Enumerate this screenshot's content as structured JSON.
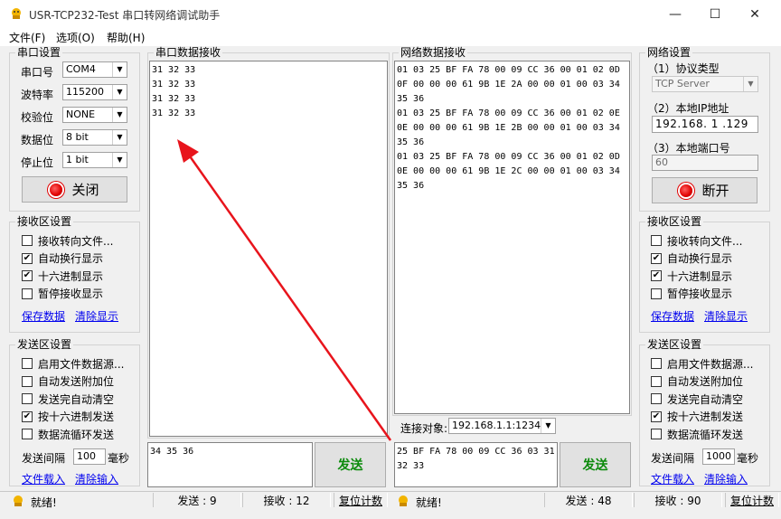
{
  "window": {
    "title": "USR-TCP232-Test 串口转网络调试助手",
    "minimize": "—",
    "maximize": "☐",
    "close": "✕"
  },
  "menu": [
    "文件(F)",
    "选项(O)",
    "帮助(H)"
  ],
  "serial_settings": {
    "title": "串口设置",
    "port_label": "串口号",
    "port_value": "COM4",
    "baud_label": "波特率",
    "baud_value": "115200",
    "parity_label": "校验位",
    "parity_value": "NONE",
    "databits_label": "数据位",
    "databits_value": "8 bit",
    "stopbits_label": "停止位",
    "stopbits_value": "1 bit",
    "close_button": "关闭"
  },
  "left_recv_settings": {
    "title": "接收区设置",
    "options": [
      {
        "label": "接收转向文件...",
        "checked": false
      },
      {
        "label": "自动换行显示",
        "checked": true
      },
      {
        "label": "十六进制显示",
        "checked": true
      },
      {
        "label": "暂停接收显示",
        "checked": false
      }
    ],
    "save_link": "保存数据",
    "clear_link": "清除显示"
  },
  "left_send_settings": {
    "title": "发送区设置",
    "options": [
      {
        "label": "启用文件数据源...",
        "checked": false
      },
      {
        "label": "自动发送附加位",
        "checked": false
      },
      {
        "label": "发送完自动清空",
        "checked": false
      },
      {
        "label": "按十六进制发送",
        "checked": true
      },
      {
        "label": "数据流循环发送",
        "checked": false
      }
    ],
    "interval_label": "发送间隔",
    "interval_value": "100",
    "interval_unit": "毫秒",
    "load_link": "文件载入",
    "clear_link": "清除输入"
  },
  "serial_recv": {
    "title": "串口数据接收",
    "content": "31 32 33\n31 32 33\n31 32 33\n31 32 33"
  },
  "serial_send": {
    "content": "34 35 36",
    "send_button": "发送"
  },
  "net_recv": {
    "title": "网络数据接收",
    "content": "01 03 25 BF FA 78 00 09 CC 36 00 01 02 0D 0F 00 00 00 61 9B 1E 2A 00 00 01 00 03 34 35 36\n01 03 25 BF FA 78 00 09 CC 36 00 01 02 0E 0E 00 00 00 61 9B 1E 2B 00 00 01 00 03 34 35 36\n01 03 25 BF FA 78 00 09 CC 36 00 01 02 0D 0E 00 00 00 61 9B 1E 2C 00 00 01 00 03 34 35 36"
  },
  "connect": {
    "label": "连接对象:",
    "value": "192.168.1.1:1234"
  },
  "net_send": {
    "content": "25 BF FA 78 00 09 CC 36 03 31 32 33",
    "send_button": "发送"
  },
  "net_settings": {
    "title": "网络设置",
    "protocol_label": "（1）协议类型",
    "protocol_value": "TCP Server",
    "ip_label": "（2）本地IP地址",
    "ip_value": "192.168. 1 .129",
    "port_label": "（3）本地端口号",
    "port_value": "60",
    "open_button": "断开"
  },
  "right_recv_settings": {
    "title": "接收区设置",
    "options": [
      {
        "label": "接收转向文件...",
        "checked": false
      },
      {
        "label": "自动换行显示",
        "checked": true
      },
      {
        "label": "十六进制显示",
        "checked": true
      },
      {
        "label": "暂停接收显示",
        "checked": false
      }
    ],
    "save_link": "保存数据",
    "clear_link": "清除显示"
  },
  "right_send_settings": {
    "title": "发送区设置",
    "options": [
      {
        "label": "启用文件数据源...",
        "checked": false
      },
      {
        "label": "自动发送附加位",
        "checked": false
      },
      {
        "label": "发送完自动清空",
        "checked": false
      },
      {
        "label": "按十六进制发送",
        "checked": true
      },
      {
        "label": "数据流循环发送",
        "checked": false
      }
    ],
    "interval_label": "发送间隔",
    "interval_value": "1000",
    "interval_unit": "毫秒",
    "load_link": "文件载入",
    "clear_link": "清除输入"
  },
  "status_left": {
    "ready": "就绪!",
    "sent": "发送 : 9",
    "received": "接收 : 12",
    "reset": "复位计数"
  },
  "status_right": {
    "ready": "就绪!",
    "sent": "发送 : 48",
    "received": "接收 : 90",
    "reset": "复位计数"
  },
  "annotation": {
    "arrow_color": "#e8141c"
  }
}
